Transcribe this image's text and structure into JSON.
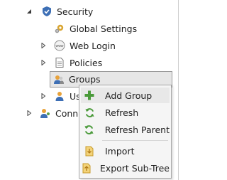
{
  "tree": {
    "security_label": "Security",
    "global_settings_label": "Global Settings",
    "web_login_label": "Web Login",
    "policies_label": "Policies",
    "groups_label": "Groups",
    "users_label_partial": "Use",
    "connections_label_partial": "Conne"
  },
  "context_menu": {
    "items": [
      {
        "label": "Add Group",
        "icon": "plus-icon"
      },
      {
        "label": "Refresh",
        "icon": "refresh-icon"
      },
      {
        "label": "Refresh Parent",
        "icon": "refresh-icon"
      },
      {
        "label": "Import",
        "icon": "import-icon"
      },
      {
        "label": "Export Sub-Tree",
        "icon": "export-icon"
      }
    ]
  },
  "colors": {
    "accent_green": "#4a9a3a",
    "folder_yellow": "#e8b84a",
    "shield_blue": "#3d6fb5",
    "selection_bg": "#e6e6e6"
  }
}
